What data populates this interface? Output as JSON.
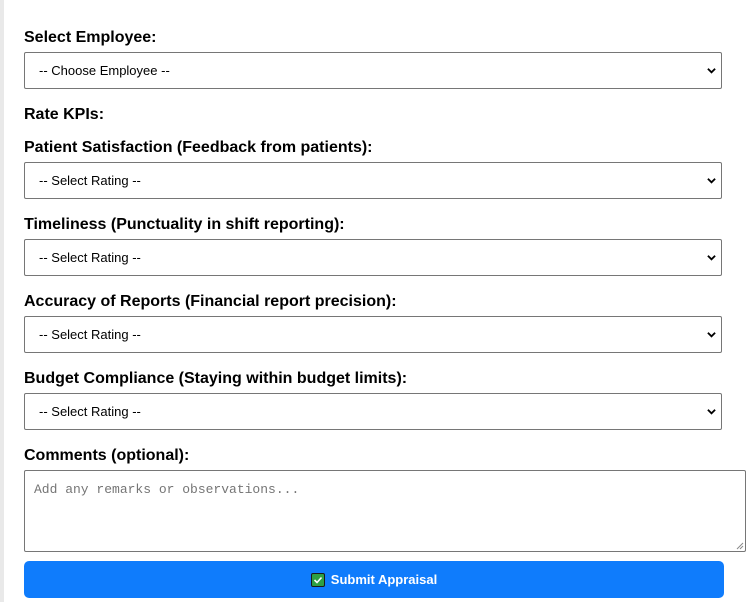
{
  "form": {
    "employee_label": "Select Employee:",
    "employee_value": "-- Choose Employee --",
    "rate_kpis_label": "Rate KPIs:",
    "kpis": [
      {
        "label": "Patient Satisfaction (Feedback from patients):",
        "value": "-- Select Rating --"
      },
      {
        "label": "Timeliness (Punctuality in shift reporting):",
        "value": "-- Select Rating --"
      },
      {
        "label": "Accuracy of Reports (Financial report precision):",
        "value": "-- Select Rating --"
      },
      {
        "label": "Budget Compliance (Staying within budget limits):",
        "value": "-- Select Rating --"
      }
    ],
    "comments_label": "Comments (optional):",
    "comments_placeholder": "Add any remarks or observations...",
    "submit_label": "Submit Appraisal"
  },
  "colors": {
    "accent": "#0f7cfc",
    "check_green": "#2ea043"
  },
  "icons": {
    "dropdown": "chevron-down-icon",
    "submit": "check-box-icon"
  }
}
